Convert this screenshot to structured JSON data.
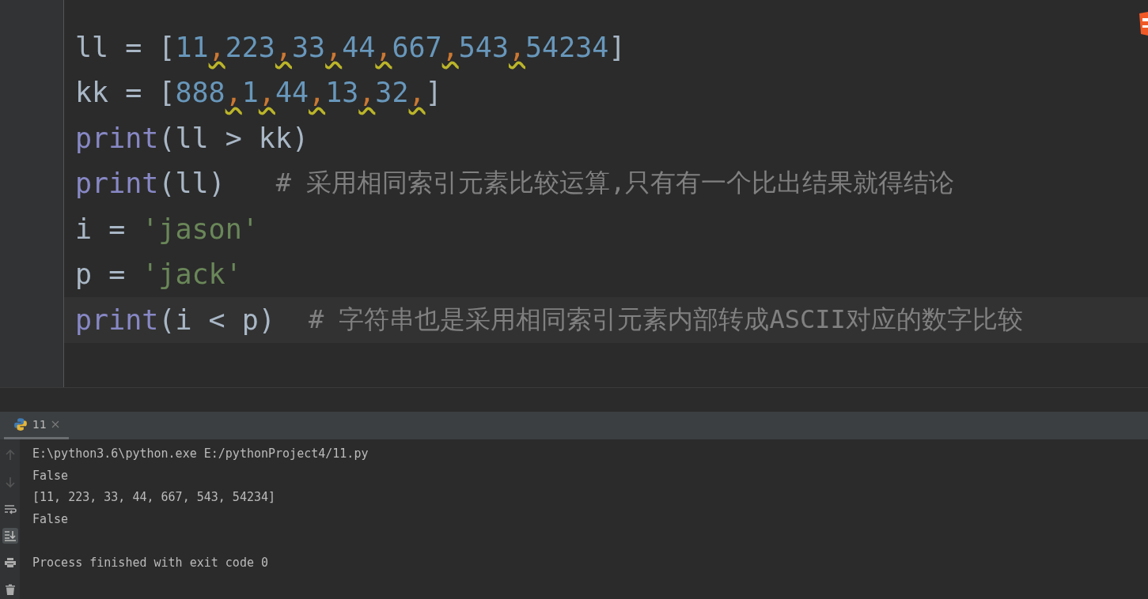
{
  "editor": {
    "lines": [
      {
        "tokens": [
          {
            "kind": "plain",
            "text": "ll = ["
          },
          {
            "kind": "number",
            "text": "11"
          },
          {
            "kind": "comma",
            "text": ","
          },
          {
            "kind": "number",
            "text": "223"
          },
          {
            "kind": "comma",
            "text": ","
          },
          {
            "kind": "number",
            "text": "33"
          },
          {
            "kind": "comma",
            "text": ","
          },
          {
            "kind": "number",
            "text": "44"
          },
          {
            "kind": "comma",
            "text": ","
          },
          {
            "kind": "number",
            "text": "667"
          },
          {
            "kind": "comma",
            "text": ","
          },
          {
            "kind": "number",
            "text": "543"
          },
          {
            "kind": "comma",
            "text": ","
          },
          {
            "kind": "number",
            "text": "54234"
          },
          {
            "kind": "plain",
            "text": "]"
          }
        ]
      },
      {
        "tokens": [
          {
            "kind": "plain",
            "text": "kk = ["
          },
          {
            "kind": "number",
            "text": "888"
          },
          {
            "kind": "comma",
            "text": ","
          },
          {
            "kind": "number",
            "text": "1"
          },
          {
            "kind": "comma",
            "text": ","
          },
          {
            "kind": "number",
            "text": "44"
          },
          {
            "kind": "comma",
            "text": ","
          },
          {
            "kind": "number",
            "text": "13"
          },
          {
            "kind": "comma",
            "text": ","
          },
          {
            "kind": "number",
            "text": "32"
          },
          {
            "kind": "comma",
            "text": ","
          },
          {
            "kind": "plain",
            "text": "]"
          }
        ]
      },
      {
        "tokens": [
          {
            "kind": "builtin",
            "text": "print"
          },
          {
            "kind": "plain",
            "text": "(ll > kk)"
          }
        ]
      },
      {
        "tokens": [
          {
            "kind": "builtin",
            "text": "print"
          },
          {
            "kind": "plain",
            "text": "(ll)"
          },
          {
            "kind": "comment",
            "text": "# 采用相同索引元素比较运算,只有有一个比出结果就得结论"
          }
        ]
      },
      {
        "tokens": [
          {
            "kind": "plain",
            "text": "i = "
          },
          {
            "kind": "string",
            "text": "'jason'"
          }
        ]
      },
      {
        "tokens": [
          {
            "kind": "plain",
            "text": "p = "
          },
          {
            "kind": "string",
            "text": "'jack'"
          }
        ]
      }
    ],
    "current_line": {
      "tokens": [
        {
          "kind": "builtin",
          "text": "print"
        },
        {
          "kind": "plain",
          "text": "(i < p)"
        },
        {
          "kind": "comment",
          "text": "# 字符串也是采用相同索引元素内部转成ASCII对应的数字比较"
        }
      ]
    }
  },
  "run_panel": {
    "tab": {
      "label": "11",
      "selected": true
    },
    "tools": [
      {
        "kind": "up",
        "on": false
      },
      {
        "kind": "down",
        "on": false
      },
      {
        "kind": "wrap",
        "on": false
      },
      {
        "kind": "scroll_end",
        "on": true
      },
      {
        "kind": "print",
        "on": false
      },
      {
        "kind": "trash",
        "on": false
      }
    ],
    "output": [
      "E:\\python3.6\\python.exe E:/pythonProject4/11.py",
      "False",
      "[11, 223, 33, 44, 667, 543, 54234]",
      "False",
      "Process finished with exit code 0"
    ]
  }
}
